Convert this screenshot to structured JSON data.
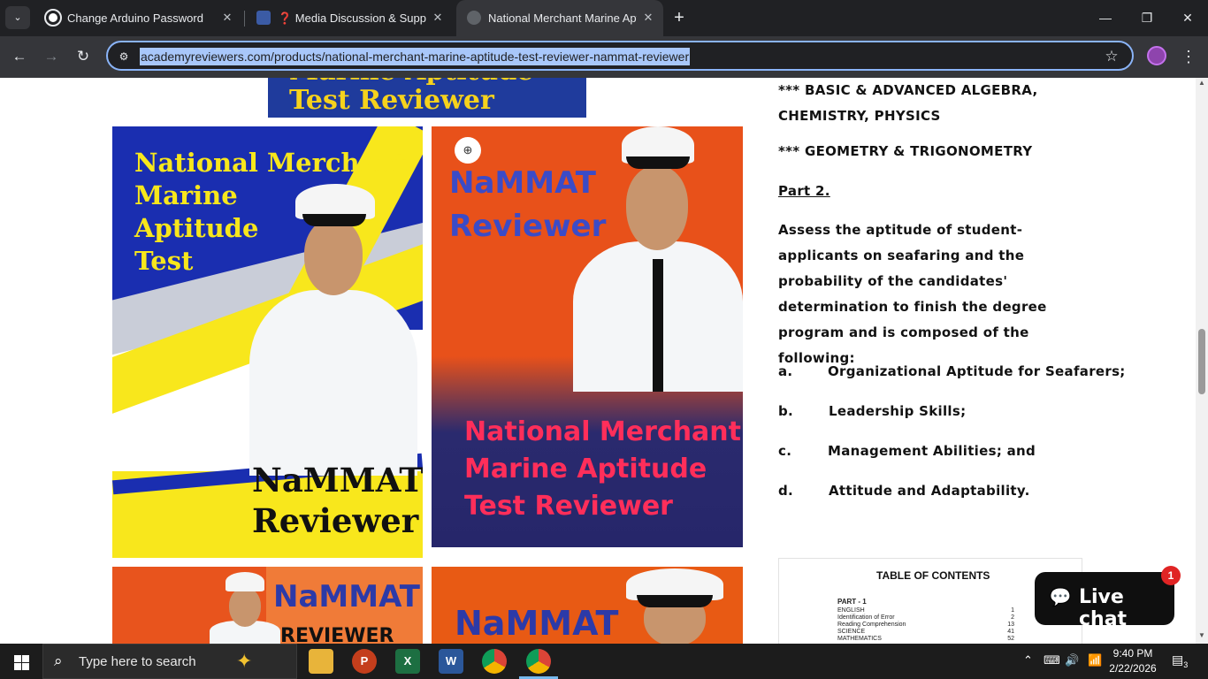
{
  "browser": {
    "tabs": [
      {
        "title": "Change Arduino Password"
      },
      {
        "title": "❓ Media Discussion & Support"
      },
      {
        "title": "National Merchant Marine Aptitude"
      }
    ],
    "url": "academyreviewers.com/products/national-merchant-marine-aptitude-test-reviewer-nammat-reviewer"
  },
  "images": {
    "top_banner_text": "Marine Aptitude\nTest Reviewer",
    "img1": {
      "headline_line1": "National  Merchant",
      "headline_line2": "Marine",
      "headline_line3": "Aptitude",
      "headline_line4": "Test",
      "footer_line1": "NaMMAT",
      "footer_line2": "Reviewer"
    },
    "img2": {
      "headline_line1": "NaMMAT",
      "headline_line2": "Reviewer",
      "footer_line1": "National Merchant",
      "footer_line2": "Marine Aptitude",
      "footer_line3": "Test  Reviewer"
    },
    "img3": {
      "line1": "NaMMAT",
      "line2": "REVIEWER"
    },
    "img4": {
      "line1": "NaMMAT"
    }
  },
  "description": {
    "line_algebra": "*** BASIC & ADVANCED ALGEBRA, CHEMISTRY, PHYSICS",
    "line_geometry": "*** GEOMETRY & TRIGONOMETRY",
    "part2_heading": "Part 2.",
    "part2_paragraph": "Assess the aptitude of student-applicants on seafaring and the probability of the candidates' determination to finish the degree program and is composed of the following:",
    "list": [
      {
        "key": "a.",
        "text": "Organizational Aptitude for Seafarers;"
      },
      {
        "key": "b.",
        "text": "Leadership Skills;"
      },
      {
        "key": "c.",
        "text": "Management Abilities; and"
      },
      {
        "key": "d.",
        "text": "Attitude and Adaptability."
      }
    ]
  },
  "toc": {
    "title": "TABLE OF CONTENTS",
    "part": "PART - 1",
    "rows": [
      {
        "label": "ENGLISH",
        "num": "1"
      },
      {
        "label": "Identification of Error",
        "num": "2"
      },
      {
        "label": "Reading Comprehension",
        "num": "13"
      },
      {
        "label": "SCIENCE",
        "num": "41"
      },
      {
        "label": "MATHEMATICS",
        "num": "52"
      }
    ]
  },
  "livechat": {
    "label": "Live chat",
    "badge": "1"
  },
  "taskbar": {
    "search_placeholder": "Type here to search",
    "time": "9:40 PM",
    "date": "2/22/2026",
    "notifications": "3"
  }
}
